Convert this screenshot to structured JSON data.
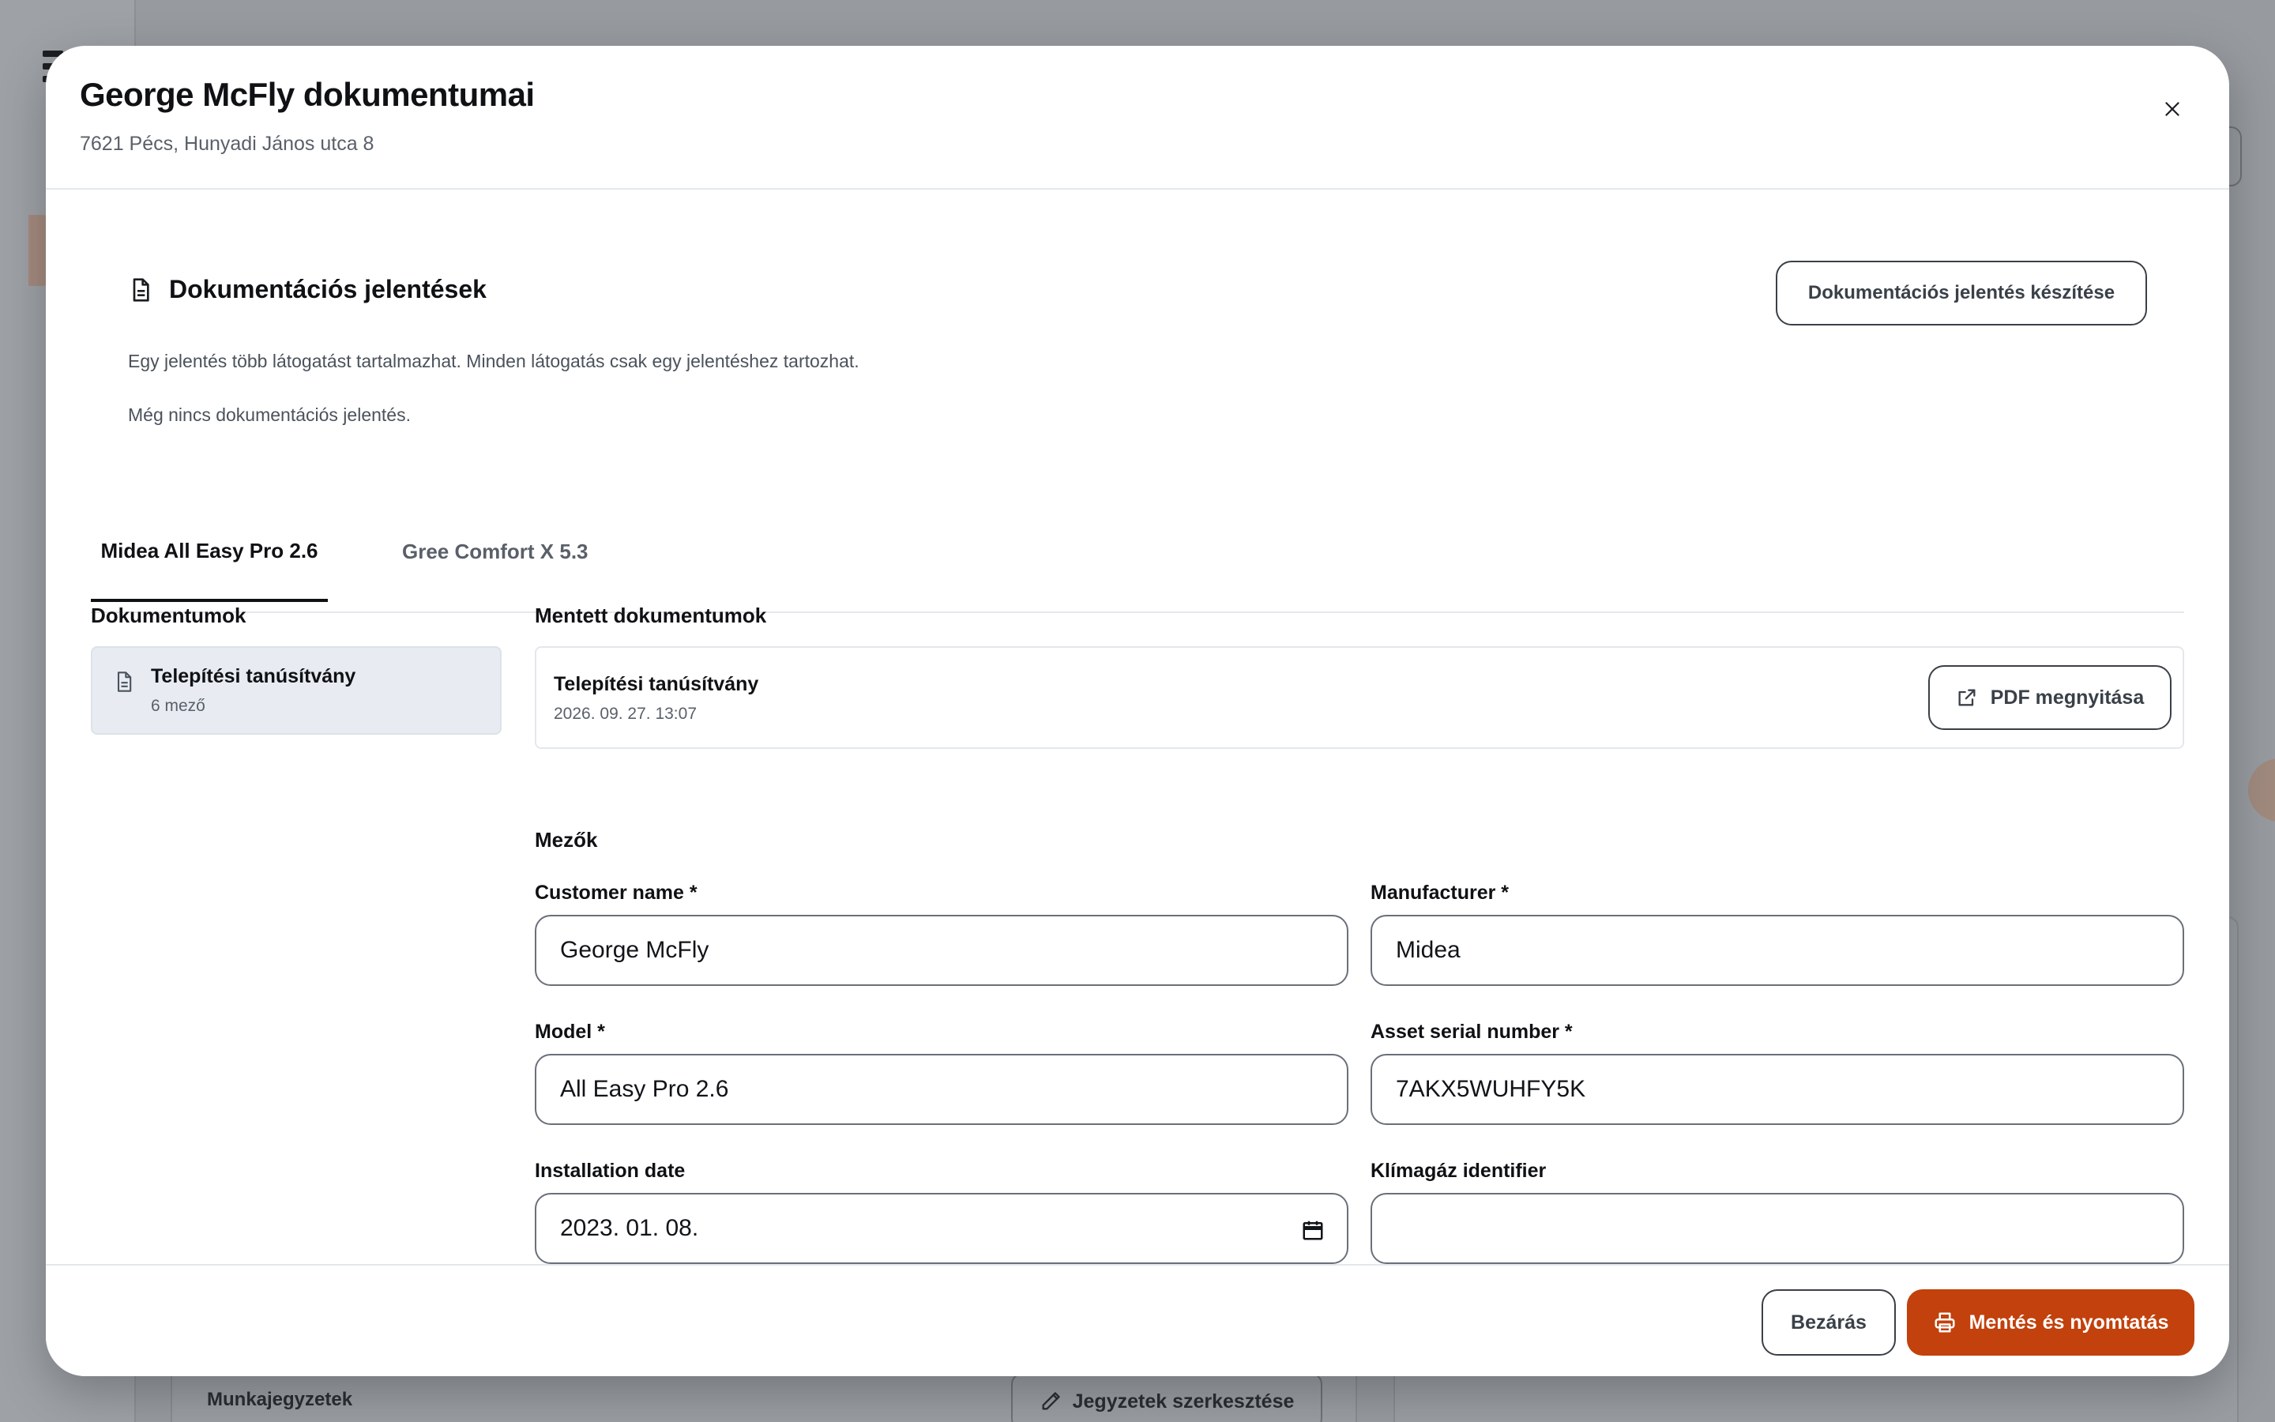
{
  "background": {
    "notes_label": "Munkajegyzetek",
    "edit_notes_button": "Jegyzetek szerkesztése"
  },
  "modal": {
    "title": "George McFly dokumentumai",
    "subtitle": "7621 Pécs, Hunyadi János utca 8",
    "close_icon": "close-icon"
  },
  "reports": {
    "icon": "document-icon",
    "title": "Dokumentációs jelentések",
    "create_button": "Dokumentációs jelentés készítése",
    "description": "Egy jelentés több látogatást tartalmazhat. Minden látogatás csak egy jelentéshez tartozhat.",
    "empty_text": "Még nincs dokumentációs jelentés."
  },
  "tabs": [
    {
      "label": "Midea All Easy Pro 2.6",
      "active": true
    },
    {
      "label": "Gree Comfort X 5.3",
      "active": false
    }
  ],
  "documents": {
    "label": "Dokumentumok",
    "items": [
      {
        "title": "Telepítési tanúsítvány",
        "subtitle": "6 mező"
      }
    ]
  },
  "saved": {
    "label": "Mentett dokumentumok",
    "item_title": "Telepítési tanúsítvány",
    "item_date": "2026. 09. 27. 13:07",
    "pdf_button": "PDF megnyitása"
  },
  "fields": {
    "label": "Mezők",
    "customer_name": {
      "label": "Customer name *",
      "value": "George McFly"
    },
    "manufacturer": {
      "label": "Manufacturer *",
      "value": "Midea"
    },
    "model": {
      "label": "Model *",
      "value": "All Easy Pro 2.6"
    },
    "asset_serial": {
      "label": "Asset serial number *",
      "value": "7AKX5WUHFY5K"
    },
    "installation_date": {
      "label": "Installation date",
      "value": "2023. 01. 08."
    },
    "klimagaz": {
      "label": "Klímagáz identifier",
      "value": ""
    }
  },
  "footer": {
    "close_button": "Bezárás",
    "save_print_button": "Mentés és nyomtatás"
  },
  "colors": {
    "accent": "#c2410c",
    "overlay": "#979ba0",
    "selected_item_bg": "#e8ecf2"
  }
}
